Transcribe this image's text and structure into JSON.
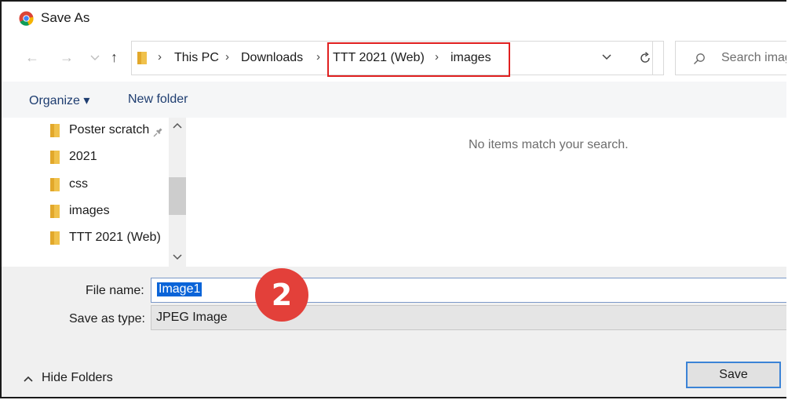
{
  "window": {
    "title": "Save As"
  },
  "nav": {
    "breadcrumbs": [
      "This PC",
      "Downloads",
      "TTT 2021 (Web)",
      "images"
    ],
    "search_placeholder": "Search imag"
  },
  "toolbar": {
    "organize_label": "Organize ▾",
    "new_folder_label": "New folder"
  },
  "folders": [
    {
      "label": "Poster scratch",
      "pinned": true
    },
    {
      "label": "2021"
    },
    {
      "label": "css"
    },
    {
      "label": "images"
    },
    {
      "label": "TTT 2021 (Web)"
    }
  ],
  "file_pane": {
    "empty_message": "No items match your search."
  },
  "form": {
    "file_name_label": "File name:",
    "file_name_value": "Image1",
    "save_as_type_label": "Save as type:",
    "save_as_type_value": "JPEG Image"
  },
  "annotation": {
    "step_number": "2",
    "highlight_color": "#e02020",
    "badge_color": "#e3403a"
  },
  "footer": {
    "hide_folders_label": "Hide Folders",
    "save_label": "Save"
  },
  "colors": {
    "folder": "#f0c14b",
    "link_blue": "#1e3d70",
    "selection": "#0a64d8"
  }
}
